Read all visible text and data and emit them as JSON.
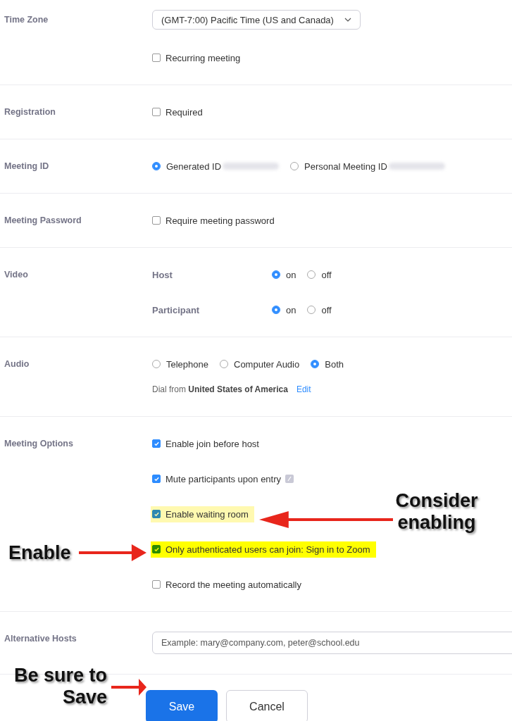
{
  "sections": [
    {
      "label": "Time Zone",
      "rows": [
        {
          "kind": "select",
          "value": "(GMT-7:00) Pacific Time (US and Canada)"
        },
        {
          "kind": "checkbox",
          "label": "Recurring meeting",
          "checked": false
        }
      ]
    },
    {
      "label": "Registration",
      "rows": [
        {
          "kind": "checkbox",
          "label": "Required",
          "checked": false
        }
      ]
    },
    {
      "label": "Meeting ID",
      "rows": [
        {
          "kind": "radios",
          "options": [
            {
              "label": "Generated ID",
              "selected": true,
              "redacted": true
            },
            {
              "label": "Personal Meeting ID",
              "selected": false,
              "redacted": true
            }
          ]
        }
      ]
    },
    {
      "label": "Meeting Password",
      "rows": [
        {
          "kind": "checkbox",
          "label": "Require meeting password",
          "checked": false
        }
      ]
    },
    {
      "label": "Video",
      "rows": [
        {
          "kind": "radios",
          "label": "Host",
          "options": [
            {
              "label": "on",
              "selected": true
            },
            {
              "label": "off",
              "selected": false
            }
          ]
        },
        {
          "kind": "radios",
          "label": "Participant",
          "options": [
            {
              "label": "on",
              "selected": true
            },
            {
              "label": "off",
              "selected": false
            }
          ]
        }
      ]
    },
    {
      "label": "Audio",
      "rows": [
        {
          "kind": "radios",
          "options": [
            {
              "label": "Telephone",
              "selected": false
            },
            {
              "label": "Computer Audio",
              "selected": false
            },
            {
              "label": "Both",
              "selected": true
            }
          ]
        },
        {
          "kind": "dial",
          "text": "Dial from **United States of America**",
          "link": "Edit"
        }
      ]
    },
    {
      "label": "Meeting Options",
      "rows": [
        {
          "kind": "checkbox",
          "label": "Enable join before host",
          "checked": true
        },
        {
          "kind": "checkbox",
          "label": "Mute participants upon entry",
          "checked": true,
          "info": true
        },
        {
          "kind": "checkbox",
          "label": "Enable waiting room",
          "checked": true,
          "color": "#fff9b0"
        },
        {
          "kind": "checkbox",
          "label": "Only authenticated users can join: Sign in to Zoom",
          "checked": true,
          "color": "#ffff00"
        },
        {
          "kind": "checkbox",
          "label": "Record the meeting automatically",
          "checked": false
        }
      ]
    },
    {
      "label": "Alternative Hosts",
      "rows": [
        {
          "kind": "input",
          "placeholder": "Example: mary@company.com, peter@school.edu"
        }
      ]
    }
  ],
  "buttons": [
    {
      "label": "Save",
      "kind": "primary"
    },
    {
      "label": "Cancel",
      "kind": "secondary"
    }
  ],
  "annotations": [
    "Consider enabling",
    "Enable",
    "Be sure to Save"
  ]
}
